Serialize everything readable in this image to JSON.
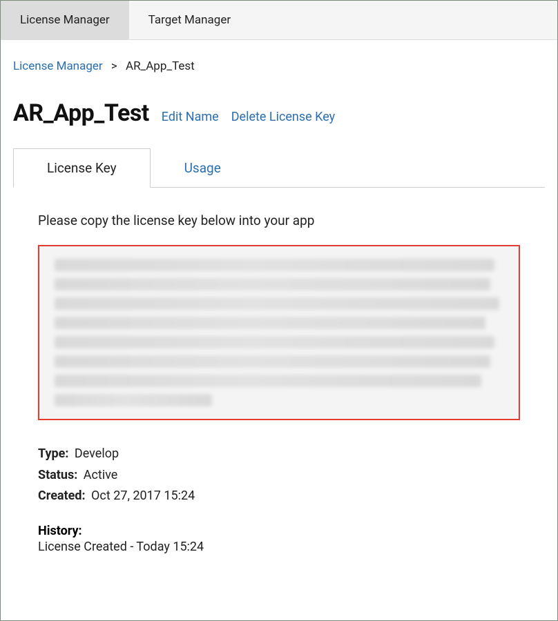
{
  "topTabs": {
    "licenseManager": "License Manager",
    "targetManager": "Target Manager"
  },
  "breadcrumb": {
    "root": "License Manager",
    "sep": ">",
    "current": "AR_App_Test"
  },
  "title": "AR_App_Test",
  "actions": {
    "edit": "Edit Name",
    "delete": "Delete License Key"
  },
  "innerTabs": {
    "licenseKey": "License Key",
    "usage": "Usage"
  },
  "instruction": "Please copy the license key below into your app",
  "meta": {
    "typeLabel": "Type:",
    "typeValue": "Develop",
    "statusLabel": "Status:",
    "statusValue": "Active",
    "createdLabel": "Created:",
    "createdValue": "Oct 27, 2017 15:24"
  },
  "history": {
    "label": "History:",
    "line": "License Created - Today 15:24"
  }
}
